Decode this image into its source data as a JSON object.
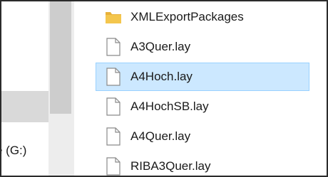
{
  "navigation_pane": {
    "drive_label": "e (G:)"
  },
  "file_list": {
    "items": [
      {
        "name": "XMLExportPackages",
        "icon": "folder-icon",
        "selected": false
      },
      {
        "name": "A3Quer.lay",
        "icon": "document-icon",
        "selected": false
      },
      {
        "name": "A4Hoch.lay",
        "icon": "document-icon",
        "selected": true
      },
      {
        "name": "A4HochSB.lay",
        "icon": "document-icon",
        "selected": false
      },
      {
        "name": "A4Quer.lay",
        "icon": "document-icon",
        "selected": false
      },
      {
        "name": "RIBA3Quer.lay",
        "icon": "document-icon",
        "selected": false
      }
    ]
  },
  "colors": {
    "selection_fill": "#cce8ff",
    "selection_border": "#99d1ff",
    "folder": "#e8b13a",
    "scrollbar_thumb": "#cdcdcd"
  }
}
